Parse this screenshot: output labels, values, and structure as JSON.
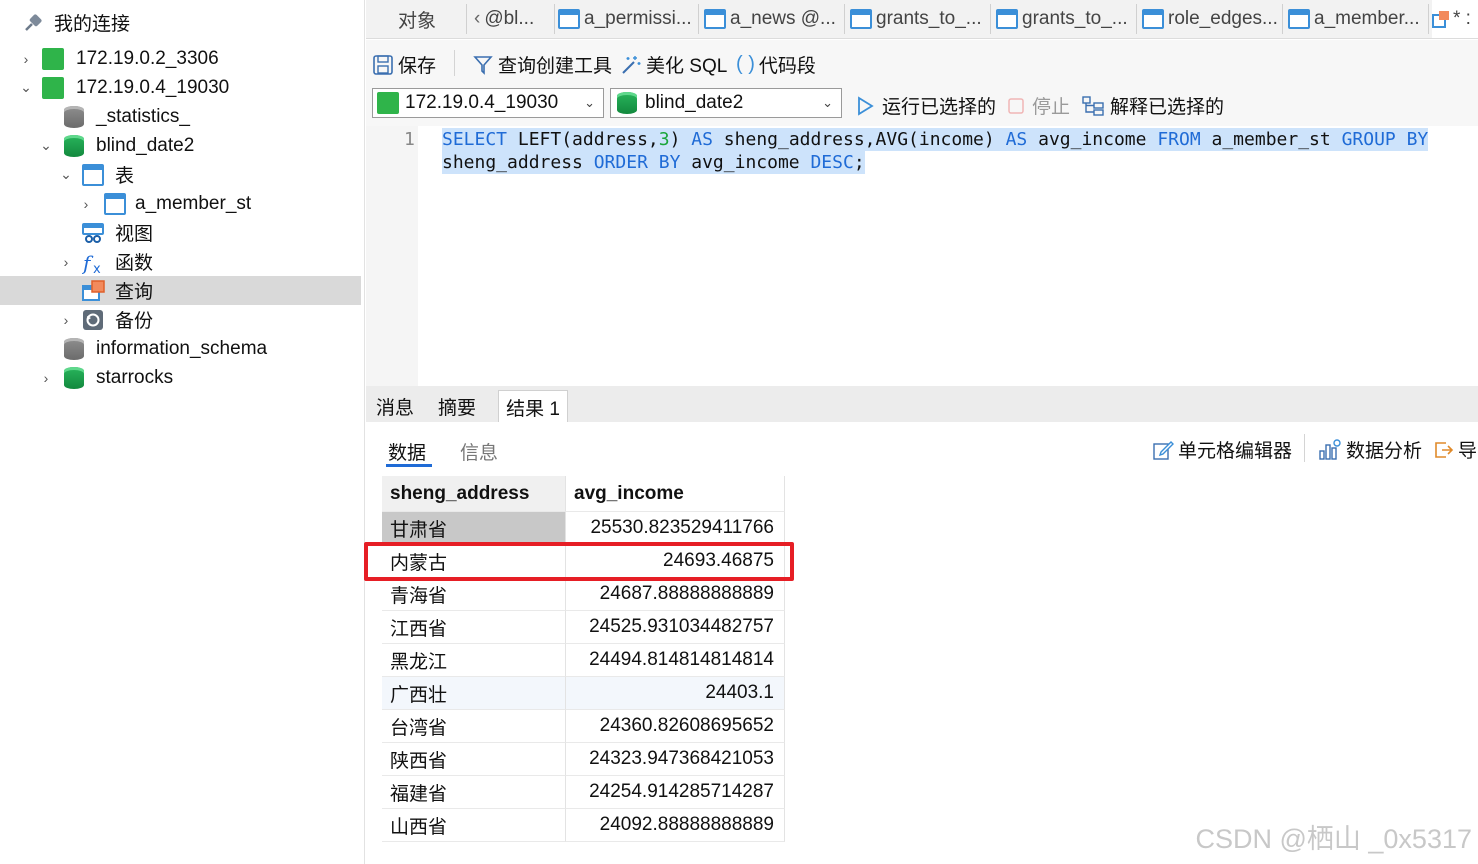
{
  "sidebar": {
    "header": "我的连接",
    "items": [
      {
        "label": "172.19.0.2_3306"
      },
      {
        "label": "172.19.0.4_19030"
      },
      {
        "label": "_statistics_"
      },
      {
        "label": "blind_date2"
      },
      {
        "label": "表"
      },
      {
        "label": "a_member_st"
      },
      {
        "label": "视图"
      },
      {
        "label": "函数"
      },
      {
        "label": "查询"
      },
      {
        "label": "备份"
      },
      {
        "label": "information_schema"
      },
      {
        "label": "starrocks"
      }
    ]
  },
  "tabs": {
    "objects": "对象",
    "items": [
      "@bl...",
      "a_permissi...",
      "a_news @...",
      "grants_to_...",
      "grants_to_...",
      "role_edges...",
      "a_member...",
      "* :"
    ]
  },
  "toolbar": {
    "save": "保存",
    "query_builder": "查询创建工具",
    "beautify": "美化 SQL",
    "snippet": "代码段"
  },
  "toolbar2": {
    "connection": "172.19.0.4_19030",
    "database": "blind_date2",
    "run_selected": "运行已选择的",
    "stop": "停止",
    "explain_selected": "解释已选择的"
  },
  "editor": {
    "line_number": "1",
    "line1": {
      "t1": "SELECT",
      "t2": " LEFT(address,",
      "t3": "3",
      "t4": ") ",
      "t5": "AS",
      "t6": " sheng_address,AVG(income) ",
      "t7": "AS",
      "t8": " avg_income ",
      "t9": "FROM",
      "t10": " a_member_st ",
      "t11": "GROUP BY"
    },
    "line2": {
      "t1": "sheng_address ",
      "t2": "ORDER BY",
      "t3": " avg_income ",
      "t4": "DESC",
      "t5": ";"
    }
  },
  "result_tabs": [
    "消息",
    "摘要",
    "结果 1"
  ],
  "sub_tabs": {
    "data": "数据",
    "info": "信息",
    "cell_editor": "单元格编辑器",
    "data_analysis": "数据分析",
    "export": "导"
  },
  "grid": {
    "columns": [
      "sheng_address",
      "avg_income"
    ],
    "rows": [
      [
        "甘肃省",
        "25530.823529411766"
      ],
      [
        "内蒙古",
        "24693.46875"
      ],
      [
        "青海省",
        "24687.88888888889"
      ],
      [
        "江西省",
        "24525.931034482757"
      ],
      [
        "黑龙江",
        "24494.814814814814"
      ],
      [
        "广西壮",
        "24403.1"
      ],
      [
        "台湾省",
        "24360.82608695652"
      ],
      [
        "陕西省",
        "24323.947368421053"
      ],
      [
        "福建省",
        "24254.914285714287"
      ],
      [
        "山西省",
        "24092.88888888889"
      ]
    ]
  },
  "watermark": "CSDN @栖山 _0x5317",
  "colors": {
    "accent": "#1f6bd6",
    "highlight_box": "#e61e25",
    "selection": "#cde3fb"
  }
}
